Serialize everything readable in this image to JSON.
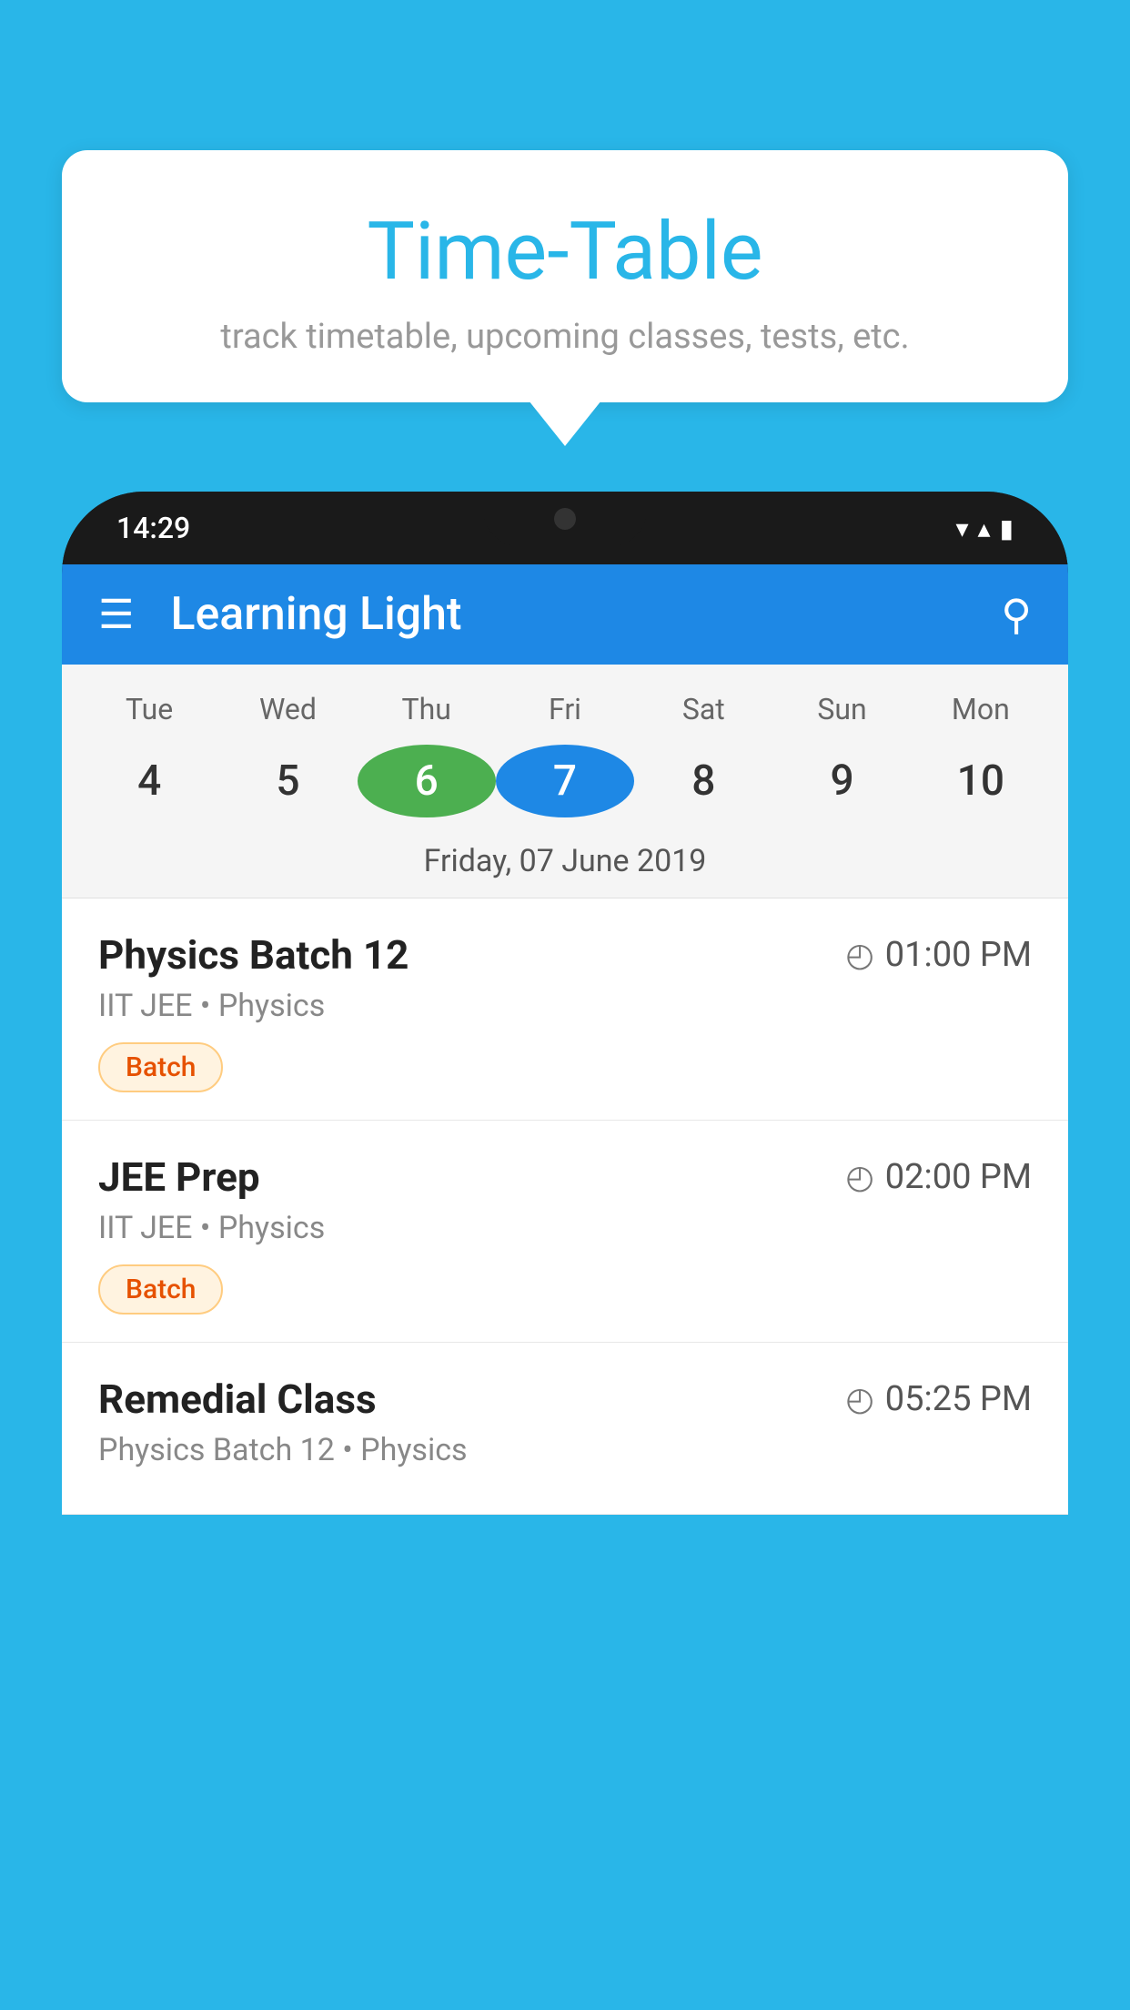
{
  "background_color": "#29b6e8",
  "tooltip": {
    "title": "Time-Table",
    "subtitle": "track timetable, upcoming classes, tests, etc."
  },
  "phone": {
    "status_bar": {
      "time": "14:29"
    },
    "app_bar": {
      "title": "Learning Light"
    },
    "calendar": {
      "days": [
        {
          "label": "Tue",
          "number": "4"
        },
        {
          "label": "Wed",
          "number": "5"
        },
        {
          "label": "Thu",
          "number": "6",
          "state": "today"
        },
        {
          "label": "Fri",
          "number": "7",
          "state": "selected"
        },
        {
          "label": "Sat",
          "number": "8"
        },
        {
          "label": "Sun",
          "number": "9"
        },
        {
          "label": "Mon",
          "number": "10"
        }
      ],
      "selected_date_label": "Friday, 07 June 2019"
    },
    "classes": [
      {
        "name": "Physics Batch 12",
        "time": "01:00 PM",
        "meta": "IIT JEE • Physics",
        "badge": "Batch"
      },
      {
        "name": "JEE Prep",
        "time": "02:00 PM",
        "meta": "IIT JEE • Physics",
        "badge": "Batch"
      },
      {
        "name": "Remedial Class",
        "time": "05:25 PM",
        "meta": "Physics Batch 12 • Physics",
        "badge": ""
      }
    ]
  },
  "icons": {
    "hamburger": "☰",
    "search": "🔍",
    "clock": "🕐",
    "wifi": "▼",
    "signal": "▲",
    "battery": "▮"
  }
}
